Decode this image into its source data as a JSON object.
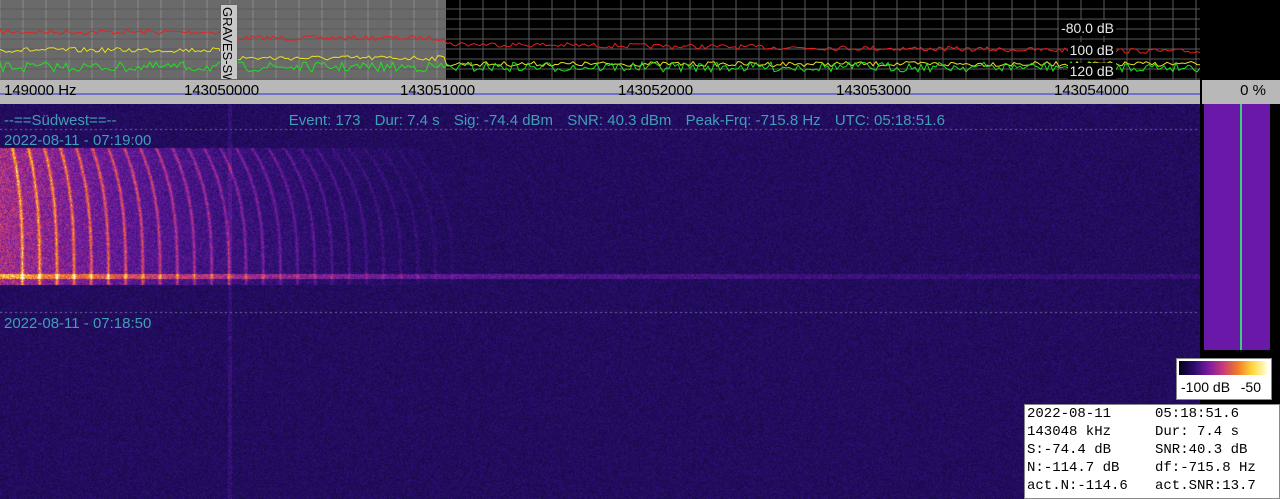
{
  "spectrum": {
    "db_labels": [
      "-80.0 dB",
      "100 dB",
      "120 dB"
    ],
    "marker_label": "GRAVES-SW",
    "colors": {
      "trace_red": "#e82020",
      "trace_yellow": "#e8e020",
      "trace_green": "#20e020",
      "highlight": "#6a6a6a",
      "grid": "#5a5a5a"
    }
  },
  "freq_axis": {
    "labels": [
      "149000 Hz",
      "143050000",
      "143051000",
      "143052000",
      "143053000",
      "143054000"
    ]
  },
  "percent": "0 %",
  "waterfall": {
    "header": "--==Südwest==--",
    "status": {
      "event": "Event: 173",
      "dur": "Dur: 7.4 s",
      "sig": "Sig: -74.4 dBm",
      "snr": "SNR: 40.3 dBm",
      "peak": "Peak-Frq: -715.8 Hz",
      "utc": "UTC: 05:18:51.6"
    },
    "timestamp_top": "2022-08-11 - 07:19:00",
    "timestamp_mid": "2022-08-11 - 07:18:50"
  },
  "colorbar": {
    "min_label": "-100 dB",
    "max_label": "-50"
  },
  "info": {
    "date": "2022-08-11",
    "time": "05:18:51.6",
    "freq": "143048 kHz",
    "dur": "Dur: 7.4 s",
    "signal": "S:-74.4 dB",
    "snr": "SNR:40.3 dB",
    "noise": "N:-114.7 dB",
    "df": "df:-715.8 Hz",
    "act_noise": "act.N:-114.6",
    "act_snr": "act.SNR:13.7"
  }
}
